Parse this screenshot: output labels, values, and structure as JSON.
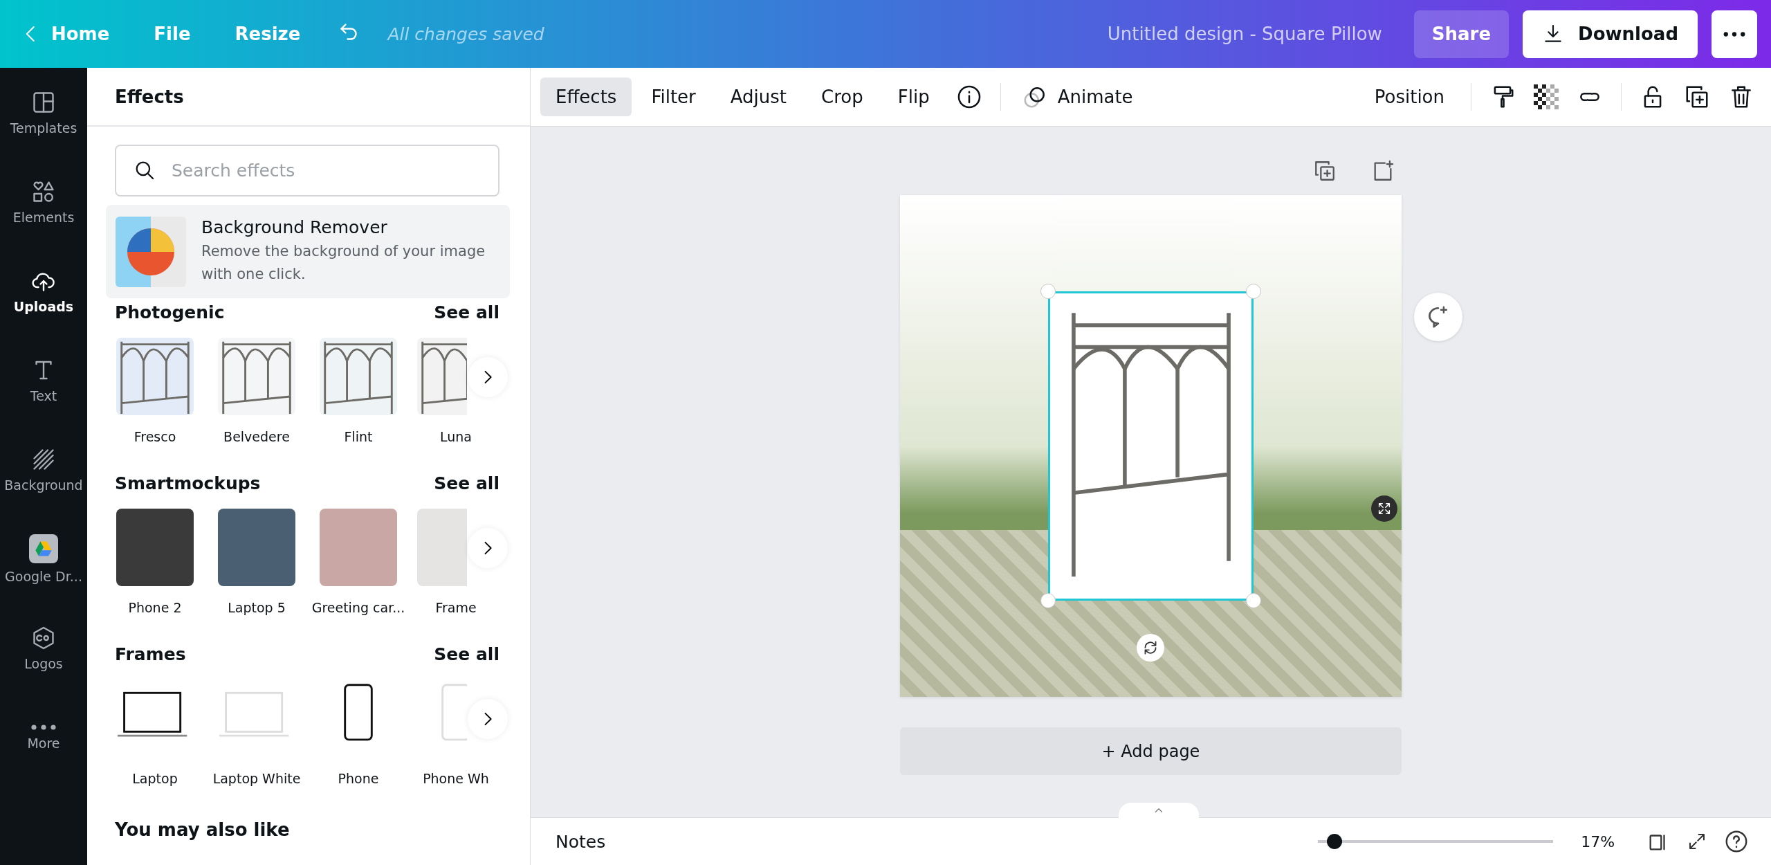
{
  "topbar": {
    "nav": [
      "Home",
      "File",
      "Resize"
    ],
    "save_status": "All changes saved",
    "title": "Untitled design - Square Pillow",
    "share": "Share",
    "download": "Download"
  },
  "rail": [
    {
      "label": "Templates",
      "kind": "templates",
      "selected": false
    },
    {
      "label": "Elements",
      "kind": "elements",
      "selected": false
    },
    {
      "label": "Uploads",
      "kind": "uploads",
      "selected": true
    },
    {
      "label": "Text",
      "kind": "text",
      "selected": false
    },
    {
      "label": "Background",
      "kind": "background",
      "selected": false
    },
    {
      "label": "Google Dr...",
      "kind": "drive",
      "selected": false
    },
    {
      "label": "Logos",
      "kind": "logos",
      "selected": false
    },
    {
      "label": "More",
      "kind": "more",
      "selected": false
    }
  ],
  "panel": {
    "title": "Effects",
    "search": {
      "placeholder": "Search effects"
    },
    "feature": {
      "title": "Background Remover",
      "description": "Remove the background of your image with one click."
    },
    "sections": [
      {
        "title": "Photogenic",
        "see_all": "See all",
        "kind": "headboard",
        "items": [
          "Fresco",
          "Belvedere",
          "Flint",
          "Luna"
        ]
      },
      {
        "title": "Smartmockups",
        "see_all": "See all",
        "kind": "mockup",
        "items": [
          "Phone 2",
          "Laptop 5",
          "Greeting car...",
          "Frame"
        ]
      },
      {
        "title": "Frames",
        "see_all": "See all",
        "kind": "frame",
        "items": [
          "Laptop",
          "Laptop White",
          "Phone",
          "Phone Wh"
        ]
      }
    ],
    "more_title": "You may also like"
  },
  "toolbar": {
    "tabs": [
      {
        "label": "Effects",
        "selected": true
      },
      {
        "label": "Filter",
        "selected": false
      },
      {
        "label": "Adjust",
        "selected": false
      },
      {
        "label": "Crop",
        "selected": false
      },
      {
        "label": "Flip",
        "selected": false
      }
    ],
    "animate": "Animate",
    "position": "Position"
  },
  "canvas": {
    "add_page": "+ Add page"
  },
  "bottom": {
    "notes": "Notes",
    "zoom": {
      "level": 0.04,
      "reading": "17%"
    }
  }
}
